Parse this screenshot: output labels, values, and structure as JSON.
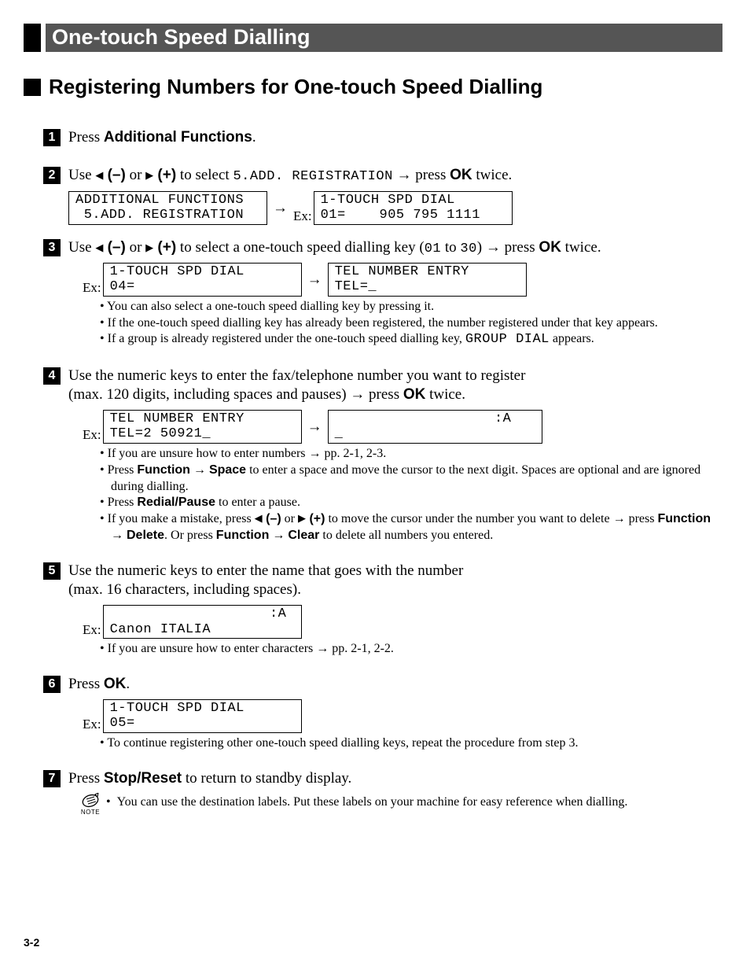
{
  "title": "One-touch Speed Dialling",
  "subtitle": "Registering Numbers for One-touch Speed Dialling",
  "steps": {
    "s1": {
      "text_a": "Press ",
      "text_b": "Additional Functions",
      "text_c": "."
    },
    "s2": {
      "intro_a": "Use ",
      "intro_minus": " (–)",
      "intro_or": " or ",
      "intro_plus": " (+)",
      "intro_b": " to select ",
      "intro_code": "5.ADD. REGISTRATION",
      "intro_c": " → press ",
      "intro_ok": "OK",
      "intro_d": " twice.",
      "lcd1": "ADDITIONAL FUNCTIONS\n 5.ADD. REGISTRATION",
      "lcd2": "1-TOUCH SPD DIAL\n01=    905 795 1111",
      "ex": "Ex:"
    },
    "s3": {
      "intro_a": "Use ",
      "intro_minus": " (–)",
      "intro_or": " or ",
      "intro_plus": " (+)",
      "intro_b": " to select a one-touch speed dialling key (",
      "intro_code1": "01",
      "intro_to": " to ",
      "intro_code2": "30",
      "intro_c": ") → press ",
      "intro_ok": "OK",
      "intro_d": " twice.",
      "lcd1": "1-TOUCH SPD DIAL\n04=",
      "lcd2": "TEL NUMBER ENTRY\nTEL=_",
      "ex": "Ex:",
      "b1": "You can also select a one-touch speed dialling key by pressing it.",
      "b2": "If the one-touch speed dialling key has already been registered, the number registered under that key appears.",
      "b3a": "If a group is already registered under the one-touch speed dialling key, ",
      "b3code": "GROUP DIAL",
      "b3b": " appears."
    },
    "s4": {
      "intro_a": "Use the numeric keys to enter the fax/telephone number you want to register",
      "intro_b": "(max. 120 digits, including spaces and pauses) → press ",
      "intro_ok": "OK",
      "intro_c": " twice.",
      "lcd1": "TEL NUMBER ENTRY\nTEL=2 50921_",
      "lcd2": "                   :A\n_",
      "ex": "Ex:",
      "b1": "If you are unsure how to enter numbers → pp. 2-1, 2-3.",
      "b2a": "Press ",
      "b2fn": "Function",
      "b2arrow": " → ",
      "b2sp": "Space",
      "b2b": " to enter a space and move the cursor to the next digit. Spaces are optional and are ignored during dialling.",
      "b3a": "Press ",
      "b3rp": "Redial/Pause",
      "b3b": " to enter a pause.",
      "b4a": "If you make a mistake, press ",
      "b4minus": " (–)",
      "b4or": " or ",
      "b4plus": " (+)",
      "b4b": " to move the cursor under the number you want to delete → press ",
      "b4fn": "Function",
      "b4arr2": " → ",
      "b4del": "Delete",
      "b4c": ". Or press ",
      "b4fn2": "Function",
      "b4arr3": " → ",
      "b4clr": "Clear",
      "b4d": " to delete all numbers you entered."
    },
    "s5": {
      "intro_a": "Use the numeric keys to enter the name that goes with the number",
      "intro_b": "(max. 16 characters, including spaces).",
      "lcd1": "                   :A\nCanon ITALIA",
      "ex": "Ex:",
      "b1": "If you are unsure how to enter characters → pp. 2-1, 2-2."
    },
    "s6": {
      "intro_a": "Press ",
      "intro_ok": "OK",
      "intro_b": ".",
      "lcd1": "1-TOUCH SPD DIAL\n05=",
      "ex": "Ex:",
      "b1": "To continue registering other one-touch speed dialling keys, repeat the procedure from step 3."
    },
    "s7": {
      "intro_a": "Press ",
      "intro_sr": "Stop/Reset",
      "intro_b": " to return to standby display.",
      "note": "You can use the destination labels. Put these labels on your machine for easy reference when dialling.",
      "note_label": "NOTE"
    }
  },
  "page_num": "3-2"
}
